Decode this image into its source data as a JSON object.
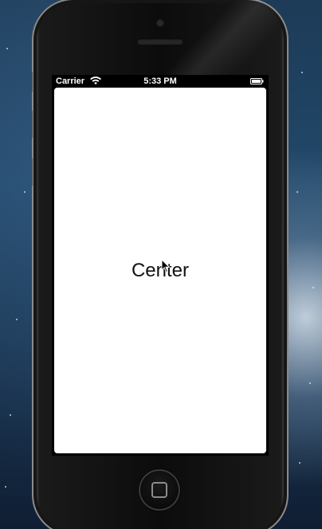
{
  "status_bar": {
    "carrier": "Carrier",
    "time": "5:33 PM",
    "wifi_icon": "wifi-icon",
    "battery_icon": "battery-icon"
  },
  "main": {
    "label": "Center"
  },
  "device": {
    "home_button_icon": "home-button-icon",
    "cursor_icon": "mouse-pointer-icon"
  },
  "colors": {
    "status_bar_bg": "#000000",
    "status_text": "#ffffff",
    "content_bg": "#ffffff",
    "label_text": "#111111"
  }
}
